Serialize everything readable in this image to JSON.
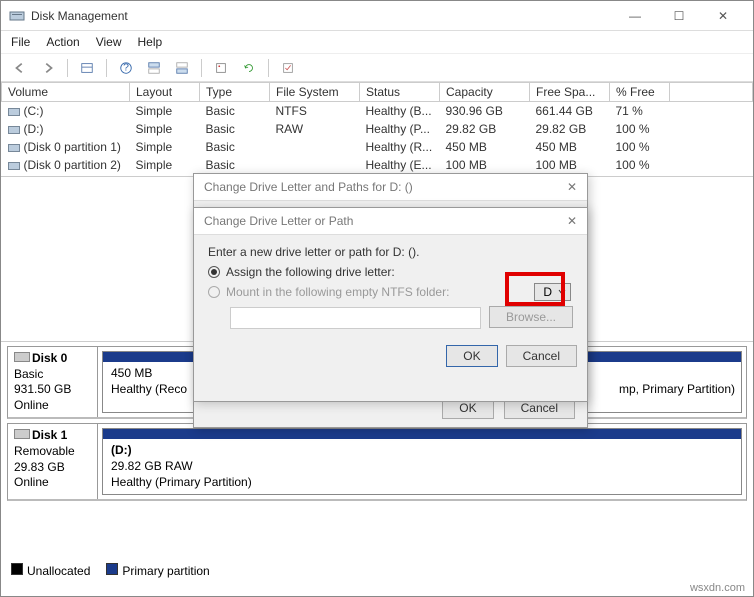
{
  "window": {
    "title": "Disk Management"
  },
  "win_controls": {
    "min": "—",
    "max": "☐",
    "close": "✕"
  },
  "menu": {
    "file": "File",
    "action": "Action",
    "view": "View",
    "help": "Help"
  },
  "columns": {
    "volume": "Volume",
    "layout": "Layout",
    "type": "Type",
    "fs": "File System",
    "status": "Status",
    "capacity": "Capacity",
    "free": "Free Spa...",
    "pct": "% Free"
  },
  "rows": [
    {
      "vol": "(C:)",
      "layout": "Simple",
      "type": "Basic",
      "fs": "NTFS",
      "status": "Healthy (B...",
      "cap": "930.96 GB",
      "free": "661.44 GB",
      "pct": "71 %"
    },
    {
      "vol": "(D:)",
      "layout": "Simple",
      "type": "Basic",
      "fs": "RAW",
      "status": "Healthy (P...",
      "cap": "29.82 GB",
      "free": "29.82 GB",
      "pct": "100 %"
    },
    {
      "vol": "(Disk 0 partition 1)",
      "layout": "Simple",
      "type": "Basic",
      "fs": "",
      "status": "Healthy (R...",
      "cap": "450 MB",
      "free": "450 MB",
      "pct": "100 %"
    },
    {
      "vol": "(Disk 0 partition 2)",
      "layout": "Simple",
      "type": "Basic",
      "fs": "",
      "status": "Healthy (E...",
      "cap": "100 MB",
      "free": "100 MB",
      "pct": "100 %"
    }
  ],
  "disks": [
    {
      "name": "Disk 0",
      "type": "Basic",
      "size": "931.50 GB",
      "state": "Online",
      "parts": [
        {
          "line1": "450 MB",
          "line2": "Healthy (Reco",
          "extra": "mp, Primary Partition)"
        }
      ]
    },
    {
      "name": "Disk 1",
      "type": "Removable",
      "size": "29.83 GB",
      "state": "Online",
      "parts": [
        {
          "line0": "(D:)",
          "line1": "29.82 GB RAW",
          "line2": "Healthy (Primary Partition)"
        }
      ]
    }
  ],
  "legend": {
    "unalloc": "Unallocated",
    "primary": "Primary partition"
  },
  "dialog_outer": {
    "title": "Change Drive Letter and Paths for D: ()",
    "ok": "OK",
    "cancel": "Cancel"
  },
  "dialog_inner": {
    "title": "Change Drive Letter or Path",
    "prompt": "Enter a new drive letter or path for D: ().",
    "opt_assign": "Assign the following drive letter:",
    "opt_mount": "Mount in the following empty NTFS folder:",
    "browse": "Browse...",
    "selected_letter": "D",
    "ok": "OK",
    "cancel": "Cancel"
  },
  "watermark": "wsxdn.com"
}
